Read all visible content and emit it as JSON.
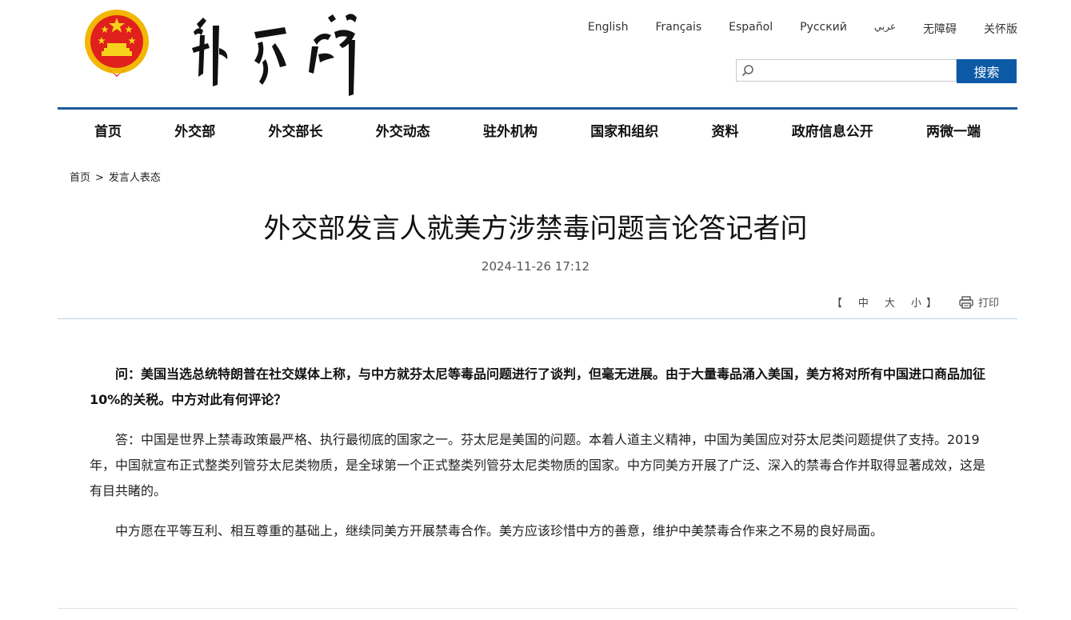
{
  "header": {
    "languages": [
      "English",
      "Français",
      "Español",
      "Русский",
      "عربي",
      "无障碍",
      "关怀版"
    ],
    "search": {
      "placeholder": "",
      "button_label": "搜索"
    }
  },
  "nav": {
    "items": [
      "首页",
      "外交部",
      "外交部长",
      "外交动态",
      "驻外机构",
      "国家和组织",
      "资料",
      "政府信息公开",
      "两微一端"
    ]
  },
  "breadcrumb": {
    "home": "首页",
    "separator": ">",
    "current": "发言人表态"
  },
  "article": {
    "title": "外交部发言人就美方涉禁毒问题言论答记者问",
    "date": "2024-11-26 17:12",
    "font_size_controls": {
      "open": "【",
      "medium": "中",
      "large": "大",
      "small": "小",
      "close": "】"
    },
    "print_label": "打印",
    "question": "问：美国当选总统特朗普在社交媒体上称，与中方就芬太尼等毒品问题进行了谈判，但毫无进展。由于大量毒品涌入美国，美方将对所有中国进口商品加征10%的关税。中方对此有何评论？",
    "answer_paragraphs": [
      "答：中国是世界上禁毒政策最严格、执行最彻底的国家之一。芬太尼是美国的问题。本着人道主义精神，中国为美国应对芬太尼类问题提供了支持。2019年，中国就宣布正式整类列管芬太尼类物质，是全球第一个正式整类列管芬太尼类物质的国家。中方同美方开展了广泛、深入的禁毒合作并取得显著成效，这是有目共睹的。",
      "中方愿在平等互利、相互尊重的基础上，继续同美方开展禁毒合作。美方应该珍惜中方的善意，维护中美禁毒合作来之不易的良好局面。"
    ]
  },
  "colors": {
    "primary_blue": "#0c5aa6",
    "rule_blue": "#1d5b9b",
    "emblem_red": "#d7201b",
    "emblem_gold": "#f3c200"
  },
  "icons": {
    "emblem": "national-emblem",
    "search": "search-icon",
    "print": "printer-icon"
  }
}
